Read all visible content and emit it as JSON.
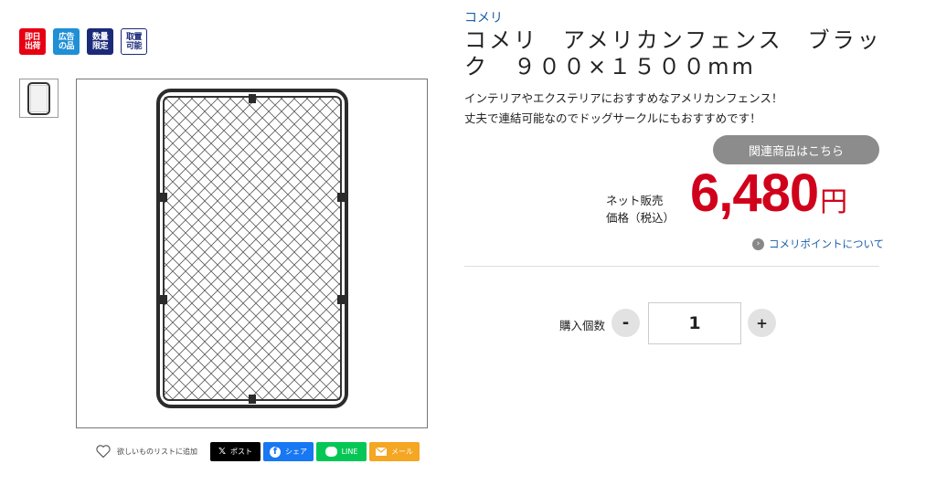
{
  "badges": [
    {
      "text": "即日\n出荷",
      "style": "red"
    },
    {
      "text": "広告\nの品",
      "style": "blue"
    },
    {
      "text": "数量\n限定",
      "style": "navy"
    },
    {
      "text": "取置\n可能",
      "style": "outline"
    }
  ],
  "product": {
    "brand": "コメリ",
    "title": "コメリ　アメリカンフェンス　ブラック　９００×１５００mm",
    "description": [
      "インテリアやエクステリアにおすすめなアメリカンフェンス！",
      "丈夫で連結可能なのでドッグサークルにもおすすめです！"
    ]
  },
  "related_button": "関連商品はこちら",
  "price": {
    "label_line1": "ネット販売",
    "label_line2": "価格（税込）",
    "amount": "6,480",
    "currency": "円",
    "color": "#d0021b"
  },
  "points_link": "コメリポイントについて",
  "quantity": {
    "label": "購入個数",
    "value": "1",
    "minus": "-",
    "plus": "+"
  },
  "wishlist": {
    "label": "欲しいものリストに追加",
    "icon": "heart-icon"
  },
  "share": {
    "x": {
      "label": "ポスト",
      "icon": "x-logo-icon"
    },
    "facebook": {
      "label": "シェア",
      "icon": "facebook-icon"
    },
    "line": {
      "label": "LINE",
      "icon": "line-icon"
    },
    "mail": {
      "label": "メール",
      "icon": "mail-icon"
    }
  },
  "colors": {
    "brand_link": "#1a5fa8",
    "badge_red": "#e60012",
    "badge_blue": "#1f8fd6",
    "badge_navy": "#1b2a78"
  }
}
